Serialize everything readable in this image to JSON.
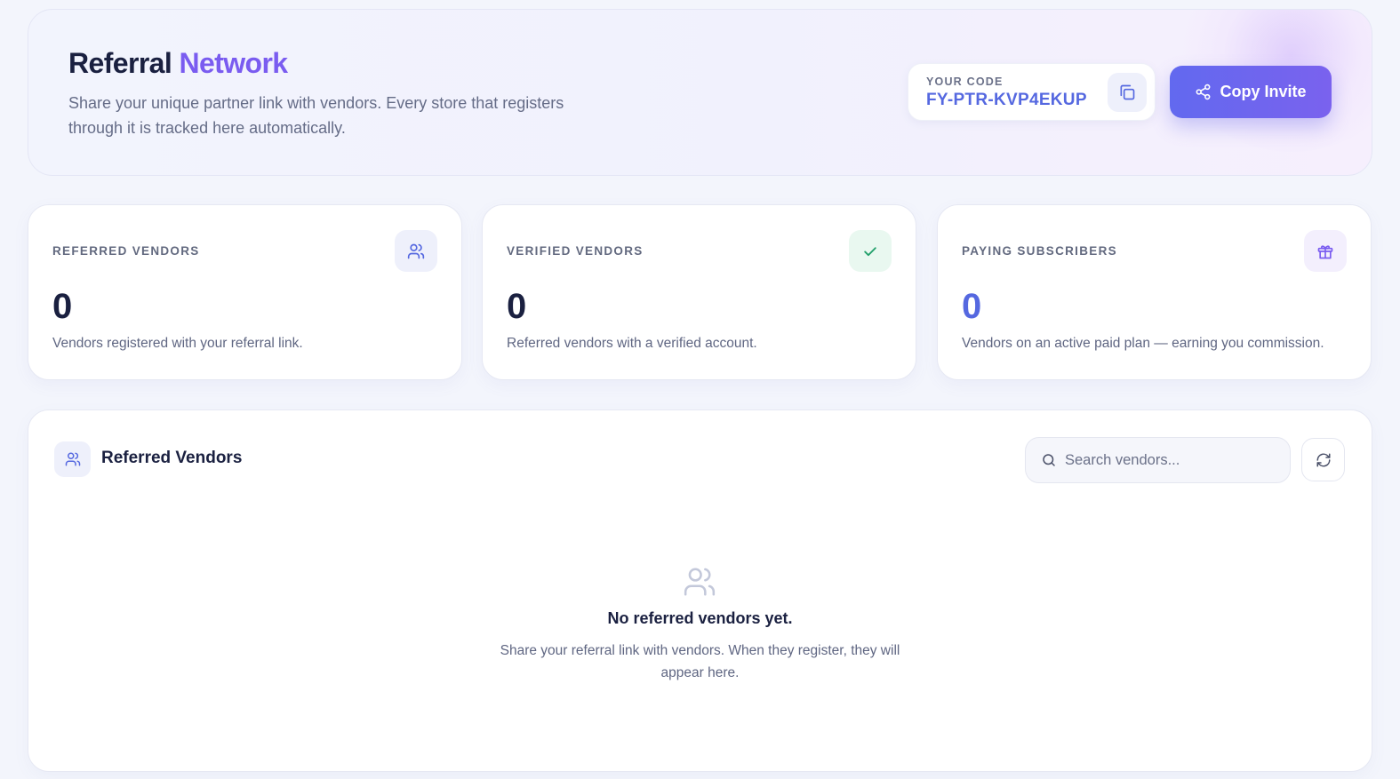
{
  "header": {
    "title_main": "Referral",
    "title_accent": "Network",
    "subtitle": "Share your unique partner link with vendors. Every store that registers through it is tracked here automatically.",
    "code_label": "YOUR CODE",
    "code_value": "FY-PTR-KVP4EKUP",
    "copy_code_icon": "copy-icon",
    "invite_label": "Copy Invite",
    "invite_icon": "share-icon"
  },
  "stats": [
    {
      "label": "REFERRED VENDORS",
      "value": "0",
      "description": "Vendors registered with your referral link.",
      "icon": "users-icon",
      "value_color": "#1a2040",
      "icon_bg": "#eef0fb",
      "icon_color": "#5568e0"
    },
    {
      "label": "VERIFIED VENDORS",
      "value": "0",
      "description": "Referred vendors with a verified account.",
      "icon": "check-icon",
      "value_color": "#1a2040",
      "icon_bg": "#e9f8f0",
      "icon_color": "#22a06b"
    },
    {
      "label": "PAYING SUBSCRIBERS",
      "value": "0",
      "description": "Vendors on an active paid plan — earning you commission.",
      "icon": "gift-icon",
      "value_color": "#5568e0",
      "icon_bg": "#f3effd",
      "icon_color": "#7a5cf0"
    }
  ],
  "panel": {
    "title": "Referred Vendors",
    "icon": "users-icon",
    "search_placeholder": "Search vendors...",
    "search_value": "",
    "refresh_icon": "refresh-icon",
    "empty_title": "No referred vendors yet.",
    "empty_desc": "Share your referral link with vendors. When they register, they will appear here."
  },
  "colors": {
    "accent": "#7a5cf0",
    "primary": "#5568e0",
    "success": "#22a06b"
  }
}
